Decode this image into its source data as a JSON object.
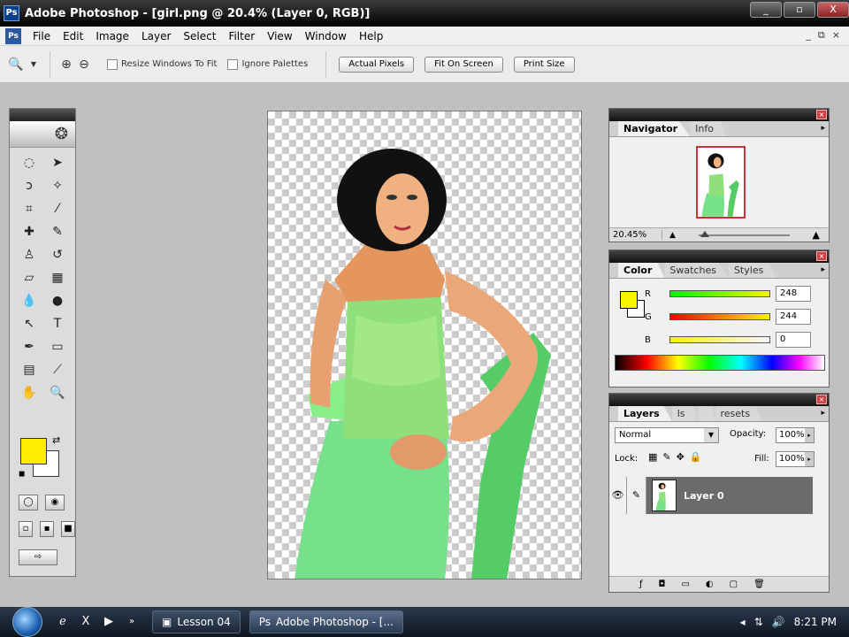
{
  "window": {
    "title": "Adobe Photoshop - [girl.png @ 20.4% (Layer 0, RGB)]",
    "controls": [
      "_",
      "▫",
      "X"
    ]
  },
  "menu": [
    "File",
    "Edit",
    "Image",
    "Layer",
    "Select",
    "Filter",
    "View",
    "Window",
    "Help"
  ],
  "mdi_controls": [
    "_",
    "⧉",
    "×"
  ],
  "options_bar": {
    "resize_windows": "Resize Windows To Fit",
    "ignore_palettes": "Ignore Palettes",
    "buttons": [
      "Actual Pixels",
      "Fit On Screen",
      "Print Size"
    ]
  },
  "navigator": {
    "tabs": [
      "Navigator",
      "Info"
    ],
    "zoom": "20.45%"
  },
  "color": {
    "tabs": [
      "Color",
      "Swatches",
      "Styles"
    ],
    "channels": [
      {
        "label": "R",
        "value": "248",
        "level": 0.97
      },
      {
        "label": "G",
        "value": "244",
        "level": 0.96
      },
      {
        "label": "B",
        "value": "0",
        "level": 0.0
      }
    ],
    "foreground": "#f8f400",
    "background": "#ffffff"
  },
  "layers": {
    "tabs": [
      "Layers",
      "ls",
      "",
      "resets"
    ],
    "blend_mode": "Normal",
    "opacity_label": "Opacity:",
    "opacity": "100%",
    "lock_label": "Lock:",
    "fill_label": "Fill:",
    "fill": "100%",
    "layer_name": "Layer 0"
  },
  "taskbar": {
    "items": [
      "Lesson 04",
      "Adobe Photoshop - [..."
    ],
    "clock": "8:21 PM"
  },
  "colors": {
    "foreground_swatch": "#ffee00",
    "dress": "#66dd77",
    "layer_row": "#6b6b6b"
  }
}
